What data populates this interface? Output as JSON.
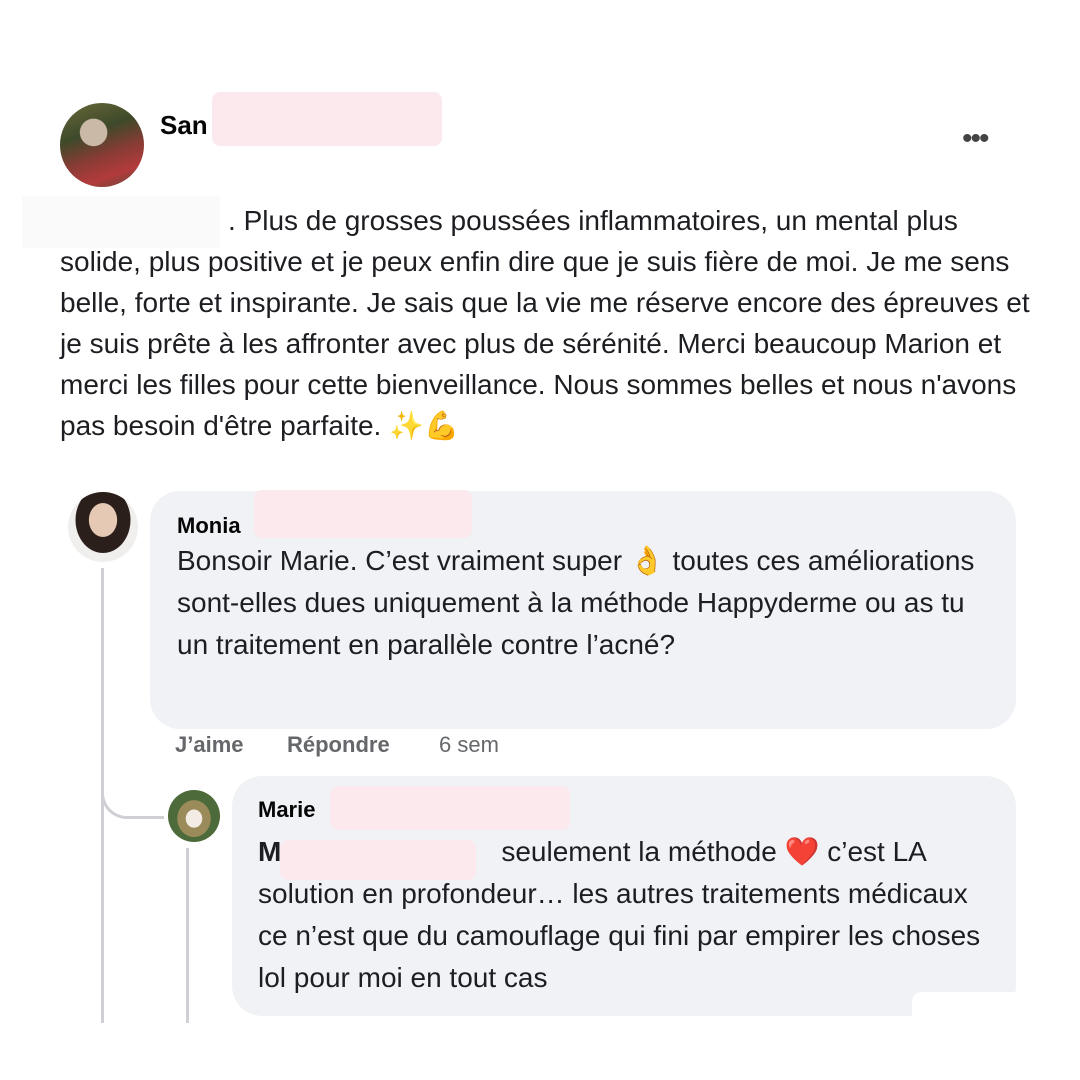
{
  "post": {
    "author_visible": "San",
    "more_label": "•••",
    "text": "Plus de grosses poussées inflammatoires, un mental plus solide, plus positive et je peux enfin dire que je suis fière de moi. Je me sens belle, forte et inspirante. Je sais que la vie me réserve encore des épreuves et je suis prête à les affronter avec plus de sérénité. Merci beaucoup Marion et merci les filles pour cette bienveillance. Nous sommes belles et nous n'avons pas besoin d'être parfaite. ✨💪",
    "leading_punct": "."
  },
  "comments": [
    {
      "author_visible": "Monia",
      "text": "Bonsoir Marie. C’est vraiment super 👌 toutes ces améliorations sont-elles dues uniquement à la méthode Happyderme ou as tu un traitement en parallèle contre l’acné?",
      "like_label": "J’aime",
      "reply_label": "Répondre",
      "time": "6 sem"
    }
  ],
  "reply": {
    "author_visible": "Marie",
    "text_start": "M",
    "text": "seulement la méthode ❤️ c’est LA solution en profondeur… les autres traitements médicaux ce n’est que du camouflage qui fini par empirer les choses lol pour moi en tout cas"
  },
  "icons": {
    "more": "more-horizontal-icon",
    "avatar": "avatar-photo"
  }
}
